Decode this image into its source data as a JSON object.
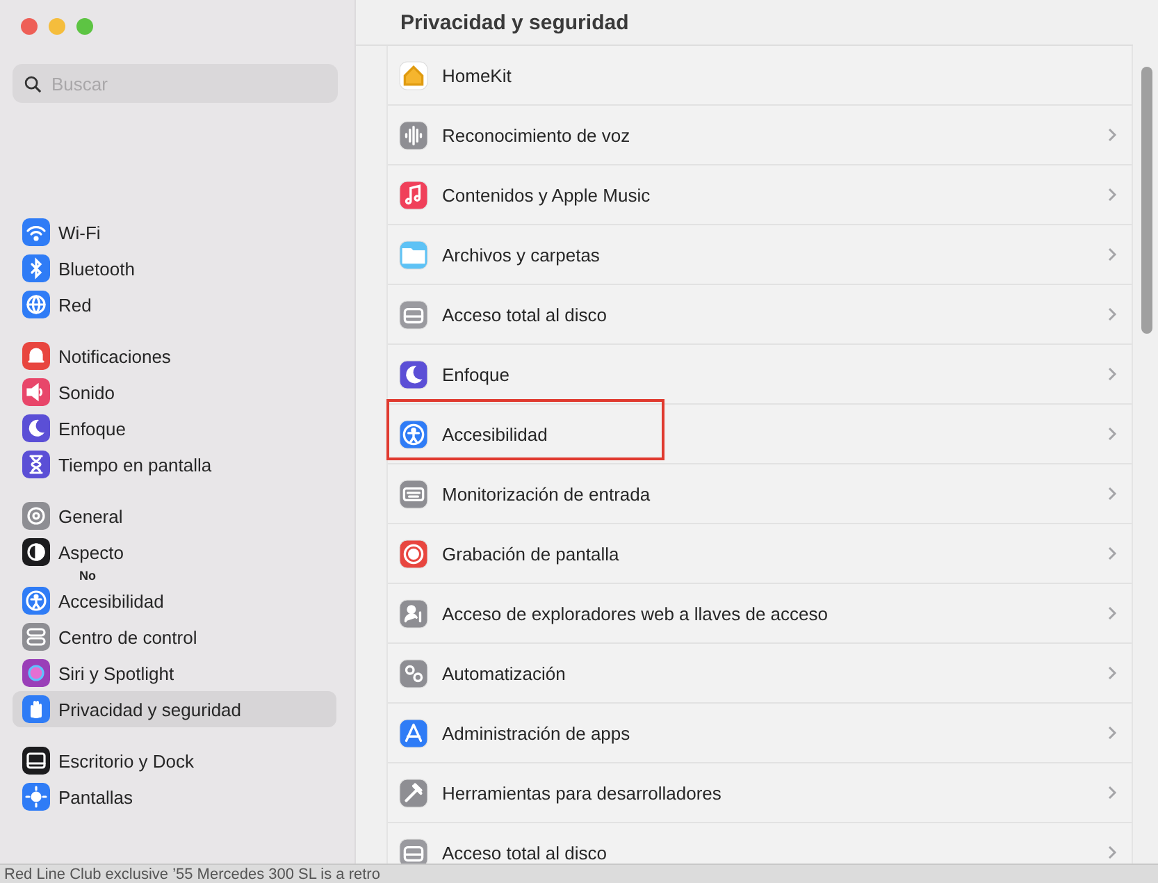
{
  "window": {
    "title": "Privacidad y seguridad"
  },
  "search": {
    "placeholder": "Buscar"
  },
  "sidebar": {
    "groups": [
      [
        {
          "label": "Wi-Fi",
          "color": "#2f7cf6",
          "selected": false
        },
        {
          "label": "Bluetooth",
          "color": "#2f7cf6",
          "selected": false
        },
        {
          "label": "Red",
          "color": "#2f7cf6",
          "selected": false
        }
      ],
      [
        {
          "label": "Notificaciones",
          "color": "#e8463f",
          "selected": false
        },
        {
          "label": "Sonido",
          "color": "#e8466a",
          "selected": false
        },
        {
          "label": "Enfoque",
          "color": "#5b4fd6",
          "selected": false
        },
        {
          "label": "Tiempo en pantalla",
          "color": "#5b4fd6",
          "selected": false
        }
      ],
      [
        {
          "label": "General",
          "color": "#8e8e93",
          "selected": false
        },
        {
          "label": "Aspecto",
          "color": "#1c1c1e",
          "selected": false
        },
        {
          "label": "Accesibilidad",
          "color": "#2f7cf6",
          "selected": false,
          "overlay": "No"
        },
        {
          "label": "Centro de control",
          "color": "#8e8e93",
          "selected": false
        },
        {
          "label": "Siri y Spotlight",
          "color": "#9a3fb8",
          "selected": false
        },
        {
          "label": "Privacidad y seguridad",
          "color": "#2f7cf6",
          "selected": true
        }
      ],
      [
        {
          "label": "Escritorio y Dock",
          "color": "#1c1c1e",
          "selected": false
        },
        {
          "label": "Pantallas",
          "color": "#2f7cf6",
          "selected": false
        }
      ]
    ]
  },
  "rows": [
    {
      "label": "HomeKit",
      "color": "#ffffff",
      "chevron": false,
      "highlighted": false
    },
    {
      "label": "Reconocimiento de voz",
      "color": "#8e8e93",
      "chevron": true,
      "highlighted": false
    },
    {
      "label": "Contenidos y Apple Music",
      "color": "#f0405a",
      "chevron": true,
      "highlighted": false
    },
    {
      "label": "Archivos y carpetas",
      "color": "#5ec2f5",
      "chevron": true,
      "highlighted": false
    },
    {
      "label": "Acceso total al disco",
      "color": "#9a9a9f",
      "chevron": true,
      "highlighted": false
    },
    {
      "label": "Enfoque",
      "color": "#5b4fd6",
      "chevron": true,
      "highlighted": false
    },
    {
      "label": "Accesibilidad",
      "color": "#2f7cf6",
      "chevron": true,
      "highlighted": true
    },
    {
      "label": "Monitorización de entrada",
      "color": "#8e8e93",
      "chevron": true,
      "highlighted": false
    },
    {
      "label": "Grabación de pantalla",
      "color": "#e8463f",
      "chevron": true,
      "highlighted": false
    },
    {
      "label": "Acceso de exploradores web a llaves de acceso",
      "color": "#8e8e93",
      "chevron": true,
      "highlighted": false
    },
    {
      "label": "Automatización",
      "color": "#8e8e93",
      "chevron": true,
      "highlighted": false
    },
    {
      "label": "Administración de apps",
      "color": "#2f7cf6",
      "chevron": true,
      "highlighted": false
    },
    {
      "label": "Herramientas para desarrolladores",
      "color": "#8e8e93",
      "chevron": true,
      "highlighted": false
    },
    {
      "label": "Acceso total al disco",
      "color": "#9a9a9f",
      "chevron": true,
      "highlighted": false
    }
  ],
  "status_bar": {
    "text": "Red Line Club exclusive ’55 Mercedes 300 SL is a retro"
  }
}
